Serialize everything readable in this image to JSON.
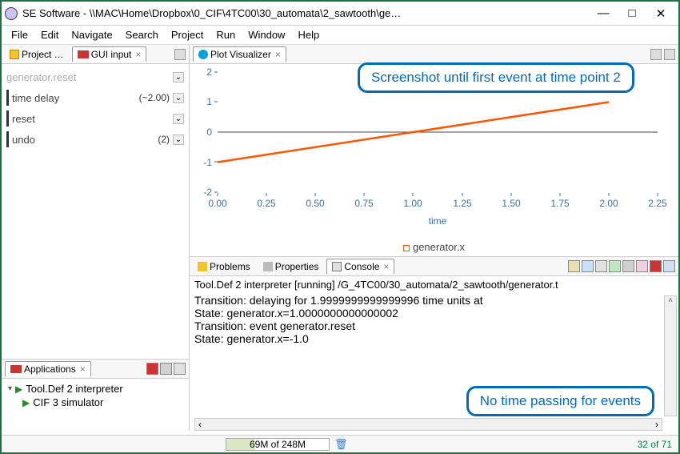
{
  "window": {
    "title": "SE Software - \\\\MAC\\Home\\Dropbox\\0_CIF\\4TC00\\30_automata\\2_sawtooth\\ge…"
  },
  "menu": [
    "File",
    "Edit",
    "Navigate",
    "Search",
    "Project",
    "Run",
    "Window",
    "Help"
  ],
  "left_tabs": {
    "project": "Project …",
    "gui": "GUI input"
  },
  "gui_rows": [
    {
      "label": "generator.reset",
      "val": "",
      "muted": true
    },
    {
      "label": "time delay",
      "val": "(~2.00)",
      "muted": false
    },
    {
      "label": "reset",
      "val": "",
      "muted": false
    },
    {
      "label": "undo",
      "val": "(2)",
      "muted": false
    }
  ],
  "apps": {
    "title": "Applications",
    "items": [
      "Tool.Def 2 interpreter",
      "CIF 3 simulator"
    ]
  },
  "plot": {
    "tab": "Plot Visualizer",
    "xlabel": "time",
    "legend_series": "generator.x",
    "annotation_top": "Screenshot until first event at time point 2",
    "annotation_bottom": "No time passing for events"
  },
  "chart_data": {
    "type": "line",
    "title": "",
    "xlabel": "time",
    "ylabel": "",
    "xlim": [
      0.0,
      2.25
    ],
    "ylim": [
      -2,
      2
    ],
    "x_ticks": [
      0.0,
      0.25,
      0.5,
      0.75,
      1.0,
      1.25,
      1.5,
      1.75,
      2.0,
      2.25
    ],
    "y_ticks": [
      -2,
      -1,
      0,
      1,
      2
    ],
    "series": [
      {
        "name": "generator.x",
        "color": "#ff5500",
        "x": [
          0.0,
          2.0
        ],
        "y": [
          -1.0,
          1.0
        ]
      }
    ]
  },
  "bottom_tabs": {
    "problems": "Problems",
    "properties": "Properties",
    "console": "Console"
  },
  "console": {
    "header": "Tool.Def 2 interpreter [running] /G_4TC00/30_automata/2_sawtooth/generator.t",
    "lines": [
      "Transition: delaying for 1.9999999999999996 time units at",
      "State: generator.x=1.0000000000000002",
      "",
      "Transition: event generator.reset",
      "State: generator.x=-1.0"
    ]
  },
  "status": {
    "heap": "69M of 248M",
    "page": "32 of 71"
  }
}
